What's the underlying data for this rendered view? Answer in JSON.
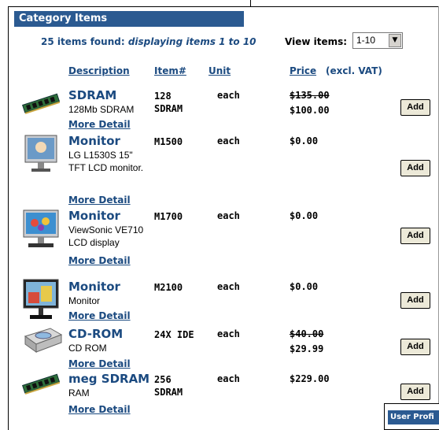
{
  "category": {
    "title": "Category Items"
  },
  "results": {
    "found_prefix": "25 items found: ",
    "found_range": "displaying items 1 to 10",
    "view_label": "View items:",
    "view_value": "1-10"
  },
  "columns": {
    "description": "Description",
    "item": "Item#",
    "unit": "Unit",
    "price": "Price",
    "price_note": "(excl. VAT)"
  },
  "products": [
    {
      "title": "SDRAM",
      "desc1": "128Mb SDRAM",
      "desc2": "",
      "item1": "128",
      "item2": "SDRAM",
      "unit": "each",
      "price_old": "$135.00",
      "price": "$100.00",
      "more": "More Detail",
      "add": "Add",
      "icon": "ram-module-icon"
    },
    {
      "title": "Monitor",
      "desc1": "LG L1530S 15\"",
      "desc2": "TFT LCD monitor.",
      "item1": "M1500",
      "item2": "",
      "unit": "each",
      "price_old": "",
      "price": "$0.00",
      "more": "More Detail",
      "add": "Add",
      "icon": "lcd-monitor-icon"
    },
    {
      "title": "Monitor",
      "desc1": "ViewSonic VE710",
      "desc2": "LCD display",
      "item1": "M1700",
      "item2": "",
      "unit": "each",
      "price_old": "",
      "price": "$0.00",
      "more": "More Detail",
      "add": "Add",
      "icon": "lcd-monitor-icon"
    },
    {
      "title": "Monitor",
      "desc1": "Monitor",
      "desc2": "",
      "item1": "M2100",
      "item2": "",
      "unit": "each",
      "price_old": "",
      "price": "$0.00",
      "more": "More Detail",
      "add": "Add",
      "icon": "lcd-monitor-icon"
    },
    {
      "title": "CD-ROM",
      "desc1": "CD ROM",
      "desc2": "",
      "item1": "24X IDE",
      "item2": "",
      "unit": "each",
      "price_old": "$40.00",
      "price": "$29.99",
      "more": "More Detail",
      "add": "Add",
      "icon": "cd-rom-drive-icon"
    },
    {
      "title": "meg SDRAM",
      "desc1": "RAM",
      "desc2": "",
      "item1": "256",
      "item2": "SDRAM",
      "unit": "each",
      "price_old": "",
      "price": "$229.00",
      "more": "More Detail",
      "add": "Add",
      "icon": "ram-module-icon"
    }
  ],
  "user_profile": {
    "title": "User Profi"
  }
}
